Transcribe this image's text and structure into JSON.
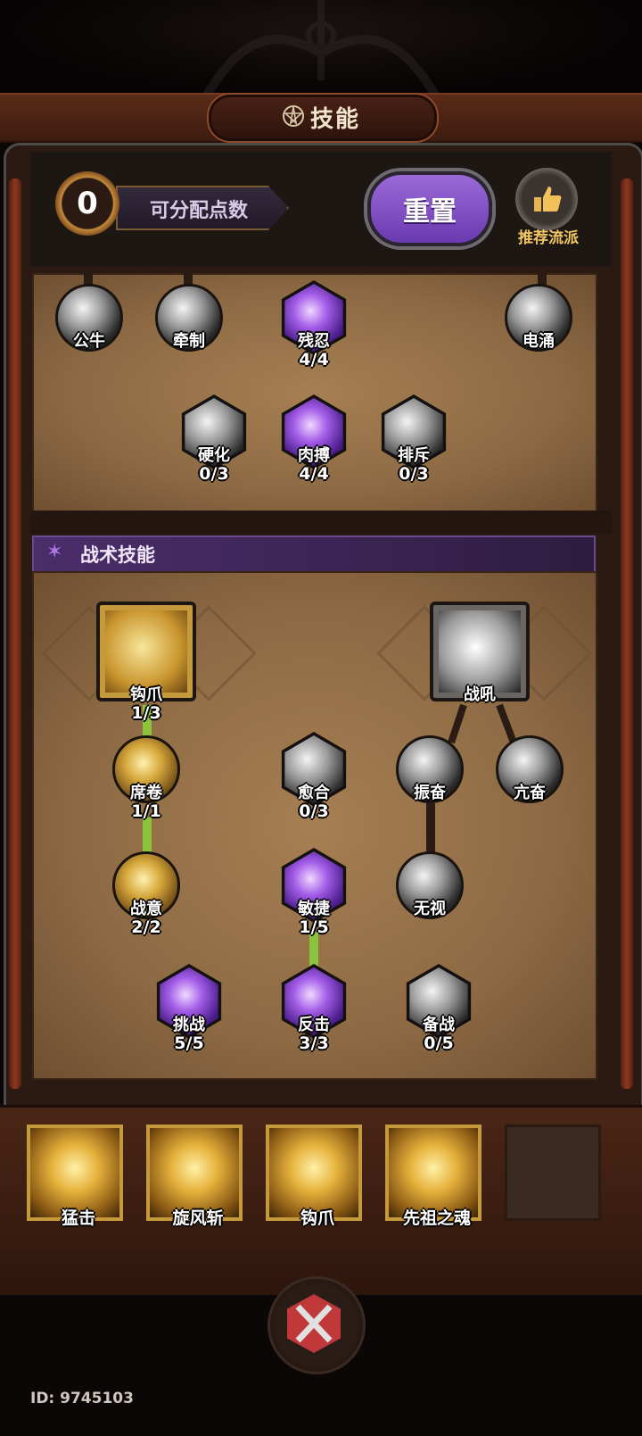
{
  "header": {
    "title": "技能",
    "points_value": "0",
    "points_label": "可分配点数",
    "reset_label": "重置",
    "recommend_label": "推荐流派"
  },
  "tree1": {
    "nodes": [
      {
        "label": "公牛",
        "level": ""
      },
      {
        "label": "牵制",
        "level": ""
      },
      {
        "label": "残忍",
        "level": "4/4"
      },
      {
        "label": "电涌",
        "level": ""
      },
      {
        "label": "硬化",
        "level": "0/3"
      },
      {
        "label": "肉搏",
        "level": "4/4"
      },
      {
        "label": "排斥",
        "level": "0/3"
      }
    ]
  },
  "tactics": {
    "section_title": "战术技能",
    "nodes": [
      {
        "label": "钩爪",
        "level": "1/3"
      },
      {
        "label": "战吼",
        "level": ""
      },
      {
        "label": "席卷",
        "level": "1/1"
      },
      {
        "label": "愈合",
        "level": "0/3"
      },
      {
        "label": "振奋",
        "level": ""
      },
      {
        "label": "亢奋",
        "level": ""
      },
      {
        "label": "战意",
        "level": "2/2"
      },
      {
        "label": "敏捷",
        "level": "1/5"
      },
      {
        "label": "无视",
        "level": ""
      },
      {
        "label": "挑战",
        "level": "5/5"
      },
      {
        "label": "反击",
        "level": "3/3"
      },
      {
        "label": "备战",
        "level": "0/5"
      }
    ]
  },
  "action_bar": {
    "slots": [
      {
        "label": "猛击"
      },
      {
        "label": "旋风斩"
      },
      {
        "label": "钩爪"
      },
      {
        "label": "先祖之魂"
      }
    ]
  },
  "footer": {
    "id_text": "ID: 9745103"
  },
  "colors": {
    "accent_purple": "#7a4ac8",
    "link_green": "#8bc43a",
    "gold": "#f1c765"
  },
  "icons": [
    "pentagram-icon",
    "thumbs-up-icon",
    "star-icon",
    "close-icon"
  ]
}
